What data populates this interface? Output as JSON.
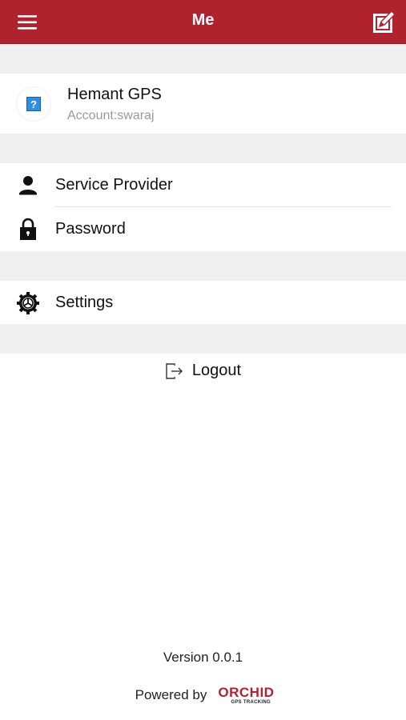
{
  "header": {
    "title": "Me",
    "menu_icon": "hamburger-menu-icon",
    "edit_icon": "edit-icon",
    "color": "#b0222e"
  },
  "profile": {
    "name": "Hemant GPS",
    "account": "Account:swaraj",
    "avatar_icon": "question-mark-icon"
  },
  "menu": {
    "service_provider": "Service Provider",
    "password": "Password",
    "settings": "Settings"
  },
  "logout": {
    "label": "Logout",
    "icon": "logout-icon"
  },
  "footer": {
    "version": "Version 0.0.1",
    "powered_by": "Powered by",
    "brand": "ORCHID",
    "brand_tagline": "GPS TRACKING"
  }
}
